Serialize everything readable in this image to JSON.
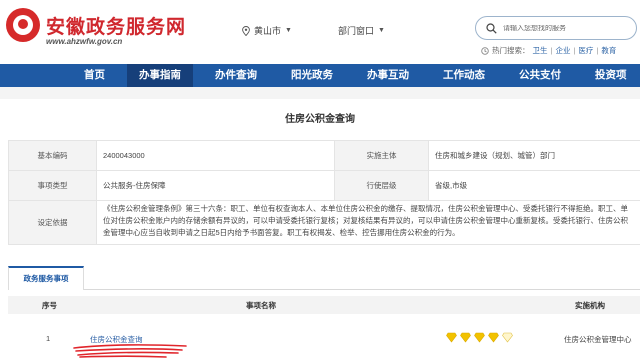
{
  "header": {
    "site_title": "安徽政务服务网",
    "site_url": "www.ahzwfw.gov.cn",
    "location_city": "黄山市",
    "location_dept": "部门窗口",
    "search_placeholder": "请输入您想找的服务",
    "hot_label": "热门搜索：",
    "hot_links": [
      "卫生",
      "企业",
      "医疗",
      "教育"
    ],
    "brand_color": "#d0282e"
  },
  "nav": {
    "items": [
      "首页",
      "办事指南",
      "办件查询",
      "阳光政务",
      "办事互动",
      "工作动态",
      "公共支付",
      "投资项"
    ],
    "active_index": 1,
    "bar_color": "#1f5aa4"
  },
  "page": {
    "title": "住房公积金查询"
  },
  "info": {
    "code_label": "基本编码",
    "code_value": "2400043000",
    "subject_label": "实施主体",
    "subject_value": "住房和城乡建设（规划、城管）部门",
    "type_label": "事项类型",
    "type_value": "公共服务-住房保障",
    "level_label": "行使层级",
    "level_value": "省级,市级",
    "basis_label": "设定依据",
    "basis_value": "《住房公积金管理条例》第三十六条：职工、单位有权查询本人、本单位住房公积金的缴存、提取情况，住房公积金管理中心、受委托银行不得拒绝。职工、单位对住房公积金账户内的存储余额有异议的，可以申请受委托银行复核；对复核结果有异议的，可以申请住房公积金管理中心重新复核。受委托银行、住房公积金管理中心应当自收到申请之日起5日内给予书面答复。职工有权揭发、检举、控告挪用住房公积金的行为。"
  },
  "tabs": {
    "active": "政务服务事项"
  },
  "list": {
    "headers": [
      "序号",
      "事项名称",
      "实施机构"
    ],
    "rows": [
      {
        "no": "1",
        "name": "住房公积金查询",
        "org": "住房公积金管理中心",
        "stars_filled": 4,
        "stars_total": 5
      }
    ]
  },
  "icons": [
    "logo-icon",
    "location-pin-icon",
    "chevron-down-icon",
    "search-icon",
    "fire-icon",
    "diamond-star-icon"
  ]
}
